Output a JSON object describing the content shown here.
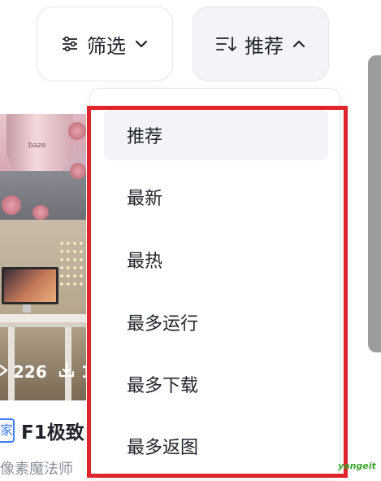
{
  "toolbar": {
    "filter": {
      "label": "筛选",
      "icon": "sliders-icon",
      "chevron": "chevron-down-icon"
    },
    "sort": {
      "label": "推荐",
      "icon": "sort-descending-icon",
      "chevron": "chevron-up-icon"
    }
  },
  "sort_menu": {
    "items": [
      {
        "label": "推荐",
        "selected": true
      },
      {
        "label": "最新"
      },
      {
        "label": "最热"
      },
      {
        "label": "最多运行"
      },
      {
        "label": "最多下载"
      },
      {
        "label": "最多返图"
      }
    ]
  },
  "cards": [
    {
      "image_text": "baze"
    },
    {
      "views": "226",
      "downloads_partial": "1"
    }
  ],
  "card_meta": {
    "tag_partial": "家",
    "title_partial": "F1极致",
    "author_partial": "像素魔法师"
  },
  "watermark": "yangeit",
  "colors": {
    "highlight": "#e0242b",
    "selected_bg": "#f2f4f7",
    "tag": "#3f7ef5"
  }
}
